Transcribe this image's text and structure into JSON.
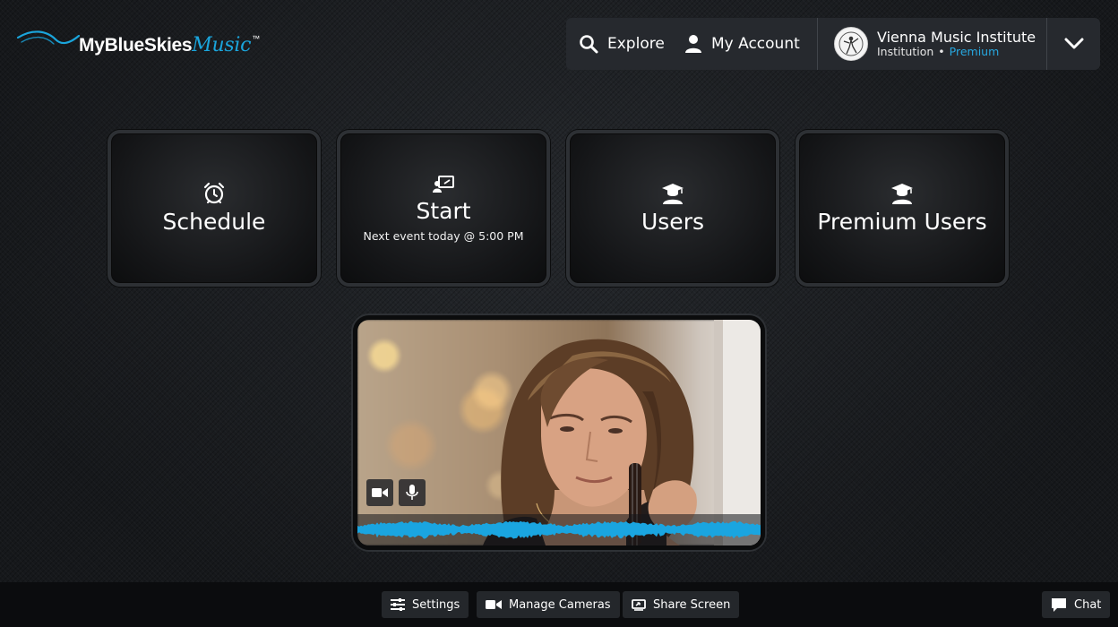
{
  "brand": {
    "name": "MyBlueSkies",
    "script": "Music",
    "trademark": "™",
    "accent_color": "#1aa5dc"
  },
  "header": {
    "explore_label": "Explore",
    "explore_icon": "search-icon",
    "account_label": "My Account",
    "account_icon": "user-icon",
    "institution": {
      "name": "Vienna Music Institute",
      "type": "Institution",
      "separator": "•",
      "tier": "Premium",
      "tier_color": "#27a8e0"
    },
    "menu_icon": "chevron-down-icon"
  },
  "tiles": [
    {
      "title": "Schedule",
      "subtitle": "",
      "icon": "alarm-clock-icon"
    },
    {
      "title": "Start",
      "subtitle": "Next event today @ 5:00 PM",
      "icon": "presentation-icon"
    },
    {
      "title": "Users",
      "subtitle": "",
      "icon": "graduate-icon"
    },
    {
      "title": "Premium Users",
      "subtitle": "",
      "icon": "graduate-icon"
    }
  ],
  "video": {
    "camera_icon": "video-camera-icon",
    "mic_icon": "microphone-icon",
    "waveform_color": "#1aa5e0"
  },
  "bottom_bar": {
    "settings_label": "Settings",
    "manage_cameras_label": "Manage Cameras",
    "share_screen_label": "Share Screen",
    "chat_label": "Chat"
  }
}
